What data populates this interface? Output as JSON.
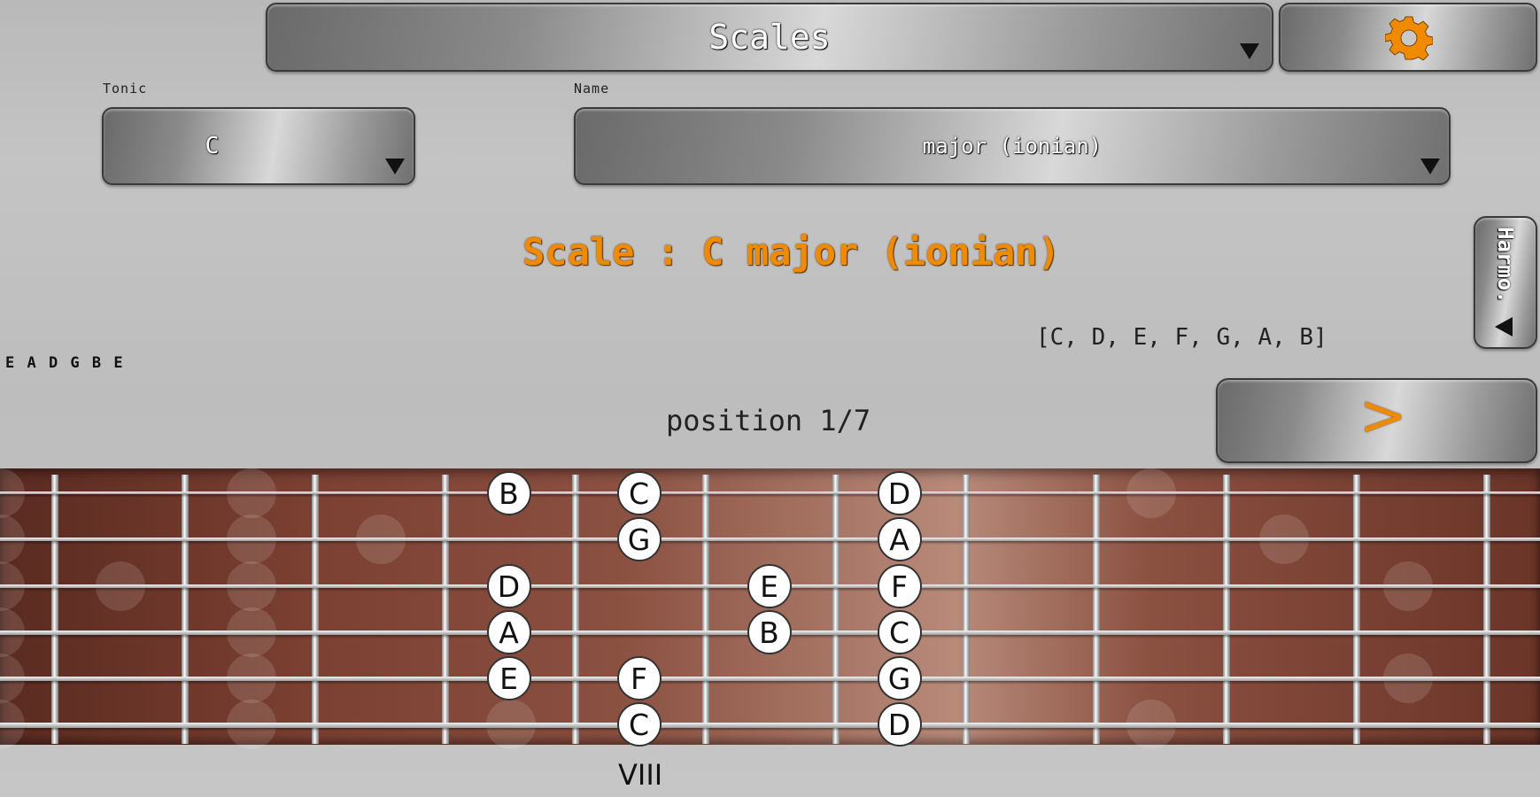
{
  "header": {
    "mode_label": "Scales",
    "settings_color": "#f08a00"
  },
  "tonic": {
    "caption": "Tonic",
    "value": "C"
  },
  "name": {
    "caption": "Name",
    "value": "major (ionian)"
  },
  "scale_title": "Scale : C major (ionian)",
  "harmo_label": "Harmo.",
  "notes_list": "[C, D, E, F, G, A, B]",
  "tuning": "E A D G B E",
  "position_label": "position 1/7",
  "next_label": ">",
  "fret_marker": "VIII",
  "accent_color": "#f08a00",
  "fretboard_notes": [
    {
      "string": 1,
      "fret": 7,
      "note": "B"
    },
    {
      "string": 1,
      "fret": 8,
      "note": "C"
    },
    {
      "string": 1,
      "fret": 10,
      "note": "D"
    },
    {
      "string": 2,
      "fret": 8,
      "note": "G"
    },
    {
      "string": 2,
      "fret": 10,
      "note": "A"
    },
    {
      "string": 3,
      "fret": 7,
      "note": "D"
    },
    {
      "string": 3,
      "fret": 9,
      "note": "E"
    },
    {
      "string": 3,
      "fret": 10,
      "note": "F"
    },
    {
      "string": 4,
      "fret": 7,
      "note": "A"
    },
    {
      "string": 4,
      "fret": 9,
      "note": "B"
    },
    {
      "string": 4,
      "fret": 10,
      "note": "C"
    },
    {
      "string": 5,
      "fret": 7,
      "note": "E"
    },
    {
      "string": 5,
      "fret": 8,
      "note": "F"
    },
    {
      "string": 5,
      "fret": 10,
      "note": "G"
    },
    {
      "string": 6,
      "fret": 8,
      "note": "C"
    },
    {
      "string": 6,
      "fret": 10,
      "note": "D"
    }
  ]
}
